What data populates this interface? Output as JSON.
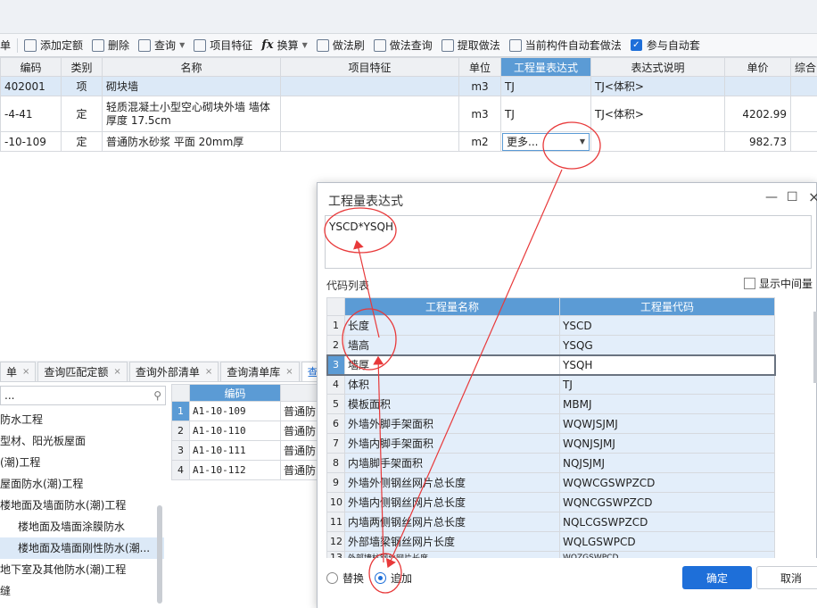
{
  "toolbar": {
    "items": [
      {
        "label": "单",
        "icon": "list-icon"
      },
      {
        "label": "添加定额",
        "icon": "add-icon"
      },
      {
        "label": "删除",
        "icon": "trash-icon"
      },
      {
        "label": "查询",
        "icon": "query-icon",
        "dropdown": true
      },
      {
        "label": "项目特征",
        "icon": "feature-icon"
      },
      {
        "label": "换算",
        "icon": "fx-icon",
        "dropdown": true
      },
      {
        "label": "做法刷",
        "icon": "brush-icon"
      },
      {
        "label": "做法查询",
        "icon": "method-query-icon"
      },
      {
        "label": "提取做法",
        "icon": "extract-icon"
      },
      {
        "label": "当前构件自动套做法",
        "icon": "auto-apply-icon"
      },
      {
        "label": "参与自动套",
        "icon": "checkbox-checked-icon"
      }
    ]
  },
  "main_grid": {
    "columns": [
      "编码",
      "类别",
      "名称",
      "项目特征",
      "单位",
      "工程量表达式",
      "表达式说明",
      "单价",
      "综合"
    ],
    "rows": [
      {
        "code": "402001",
        "type": "项",
        "name": "砌块墙",
        "feature": "",
        "unit": "m3",
        "expr": "TJ",
        "desc": "TJ<体积>",
        "price": ""
      },
      {
        "code": "-4-41",
        "type": "定",
        "name": "轻质混凝土小型空心砌块外墙 墙体厚度 17.5cm",
        "feature": "",
        "unit": "m3",
        "expr": "TJ",
        "desc": "TJ<体积>",
        "price": "4202.99"
      },
      {
        "code": "-10-109",
        "type": "定",
        "name": "普通防水砂浆 平面 20mm厚",
        "feature": "",
        "unit": "m2",
        "expr": "更多...",
        "desc": "",
        "price": "982.73"
      }
    ]
  },
  "bottom_tabs": [
    {
      "label": "单",
      "close": "×"
    },
    {
      "label": "查询匹配定额",
      "close": "×"
    },
    {
      "label": "查询外部清单",
      "close": "×"
    },
    {
      "label": "查询清单库",
      "close": "×"
    },
    {
      "label": "查询",
      "close": ""
    }
  ],
  "search": {
    "value": "..."
  },
  "tree": [
    {
      "label": "防水工程",
      "level": 1
    },
    {
      "label": "型材、阳光板屋面",
      "level": 1
    },
    {
      "label": "(潮)工程",
      "level": 1
    },
    {
      "label": "屋面防水(潮)工程",
      "level": 1
    },
    {
      "label": "楼地面及墙面防水(潮)工程",
      "level": 1
    },
    {
      "label": "楼地面及墙面涂膜防水",
      "level": 2
    },
    {
      "label": "楼地面及墙面刚性防水(潮...",
      "level": 2,
      "selected": true
    },
    {
      "label": "地下室及其他防水(潮)工程",
      "level": 1
    },
    {
      "label": "缝",
      "level": 1
    }
  ],
  "left_grid": {
    "header": "编码",
    "rows": [
      {
        "num": "1",
        "code": "A1-10-109",
        "name": "普通防"
      },
      {
        "num": "2",
        "code": "A1-10-110",
        "name": "普通防"
      },
      {
        "num": "3",
        "code": "A1-10-111",
        "name": "普通防"
      },
      {
        "num": "4",
        "code": "A1-10-112",
        "name": "普通防"
      }
    ]
  },
  "dialog": {
    "title": "工程量表达式",
    "minimize": "—",
    "maximize": "☐",
    "close": "×",
    "expression": "YSCD*YSQH",
    "code_list_label": "代码列表",
    "show_intermediate": "显示中间量",
    "columns": [
      "工程量名称",
      "工程量代码"
    ],
    "rows": [
      {
        "num": "1",
        "name": "长度",
        "code": "YSCD"
      },
      {
        "num": "2",
        "name": "墙高",
        "code": "YSQG"
      },
      {
        "num": "3",
        "name": "墙厚",
        "code": "YSQH"
      },
      {
        "num": "4",
        "name": "体积",
        "code": "TJ"
      },
      {
        "num": "5",
        "name": "模板面积",
        "code": "MBMJ"
      },
      {
        "num": "6",
        "name": "外墙外脚手架面积",
        "code": "WQWJSJMJ"
      },
      {
        "num": "7",
        "name": "外墙内脚手架面积",
        "code": "WQNJSJMJ"
      },
      {
        "num": "8",
        "name": "内墙脚手架面积",
        "code": "NQJSJMJ"
      },
      {
        "num": "9",
        "name": "外墙外侧钢丝网片总长度",
        "code": "WQWCGSWPZCD"
      },
      {
        "num": "10",
        "name": "外墙内侧钢丝网片总长度",
        "code": "WQNCGSWPZCD"
      },
      {
        "num": "11",
        "name": "内墙两侧钢丝网片总长度",
        "code": "NQLCGSWPZCD"
      },
      {
        "num": "12",
        "name": "外部墙梁钢丝网片长度",
        "code": "WQLGSWPCD"
      },
      {
        "num": "13",
        "name": "外部墙柱钢丝网片长度",
        "code": "WQZGSWPCD"
      }
    ],
    "selected_row": 3,
    "radio_replace": "替换",
    "radio_append": "追加",
    "ok": "确定",
    "cancel": "取消"
  },
  "colors": {
    "accent": "#1e6fd9",
    "header_blue": "#5b9bd5",
    "annotation_red": "#e8393a"
  }
}
